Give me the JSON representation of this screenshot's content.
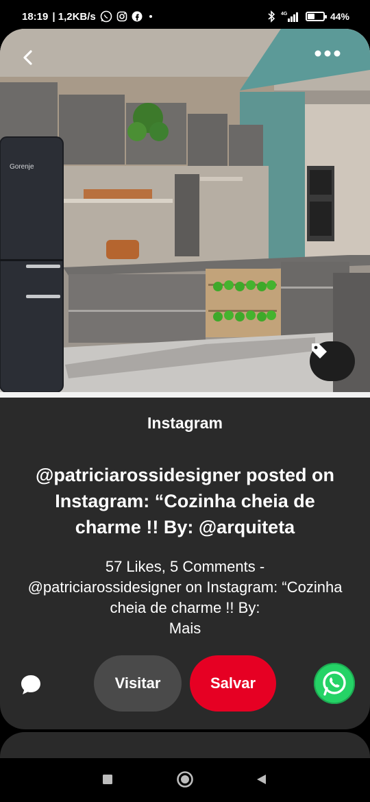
{
  "status_bar": {
    "time": "18:19",
    "speed": "| 1,2KB/s",
    "network": "4G",
    "battery_text": "44%",
    "battery_level": 0.44,
    "icons": [
      "whatsapp-icon",
      "instagram-icon",
      "facebook-icon",
      "dot-icon",
      "bluetooth-icon",
      "signal-icon",
      "battery-icon"
    ]
  },
  "hero": {
    "image_subject": "kitchen-photo",
    "appliance_brand": "Gorenje",
    "icons": [
      "back-arrow-icon",
      "more-dots-icon",
      "tag-icon"
    ]
  },
  "pin": {
    "source": "Instagram",
    "title": "@patriciarossidesigner posted on Instagram: “Cozinha cheia de charme !! By: @arquiteta",
    "description": "57 Likes, 5 Comments - @patriciarossidesigner on Instagram: “Cozinha cheia de charme !! By:",
    "more_label": "Mais"
  },
  "actions": {
    "visit_label": "Visitar",
    "save_label": "Salvar",
    "save_color": "#e60023",
    "whatsapp_color": "#25d366"
  }
}
